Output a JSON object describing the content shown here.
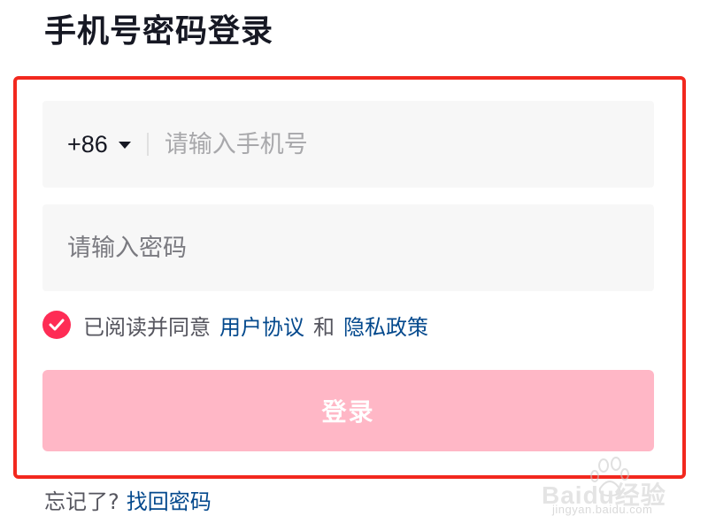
{
  "header": {
    "title": "手机号密码登录"
  },
  "form": {
    "country_code": "+86",
    "phone_placeholder": "请输入手机号",
    "phone_value": "",
    "password_placeholder": "请输入密码",
    "password_value": "",
    "agreement": {
      "checked": true,
      "prefix": "已阅读并同意",
      "terms_link": "用户协议",
      "conjunction": "和",
      "privacy_link": "隐私政策"
    },
    "login_button": "登录"
  },
  "footer": {
    "forgot_prefix": "忘记了?",
    "forgot_link": "找回密码"
  },
  "watermark": {
    "brand": "Baidu经验",
    "url": "jingyan.baidu.com"
  },
  "colors": {
    "accent": "#fe2c55",
    "button_disabled": "#ffb7c6",
    "link": "#04498d",
    "highlight_border": "#f2281e",
    "field_bg": "#f7f7f7"
  },
  "icons": {
    "country_dropdown": "caret-down-icon",
    "agreement_check": "check-circle-icon"
  }
}
